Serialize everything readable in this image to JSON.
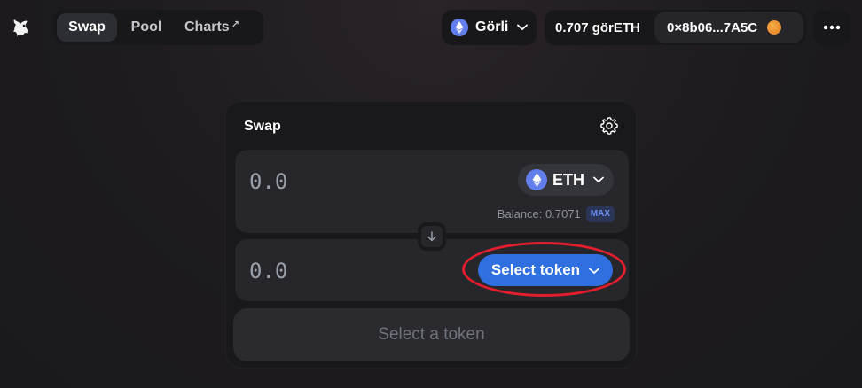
{
  "nav": {
    "tabs": [
      {
        "label": "Swap",
        "active": true
      },
      {
        "label": "Pool",
        "active": false
      },
      {
        "label": "Charts",
        "suffix": "↗",
        "active": false
      }
    ]
  },
  "network": {
    "label": "Görli",
    "icon": "ethereum-icon"
  },
  "wallet": {
    "balance": "0.707 görETH",
    "address": "0×8b06...7A5C"
  },
  "swap": {
    "title": "Swap",
    "input": {
      "amount": "0.0",
      "token": "ETH",
      "balance_label": "Balance: 0.7071",
      "max_label": "MAX"
    },
    "output": {
      "amount": "0.0",
      "select_label": "Select token"
    },
    "action_label": "Select a token"
  },
  "colors": {
    "accent": "#2f6fdf",
    "eth": "#627eea",
    "highlight": "#e01e2d"
  }
}
